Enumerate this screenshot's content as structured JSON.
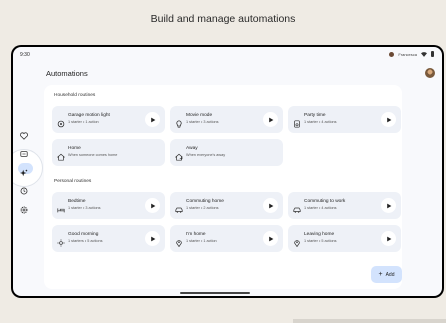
{
  "headline": "Build and manage automations",
  "status": {
    "time": "9:30",
    "user": "Francesca"
  },
  "page_title": "Automations",
  "sections": [
    {
      "title": "Household routines",
      "cards": [
        {
          "title": "Garage motion light",
          "subtitle": "1 starter • 1 action",
          "icon": "motion-sensor-icon",
          "has_play": true
        },
        {
          "title": "Movie mode",
          "subtitle": "1 starter • 3 actions",
          "icon": "lightbulb-icon",
          "has_play": true
        },
        {
          "title": "Party time",
          "subtitle": "1 starter • 4 actions",
          "icon": "speaker-icon",
          "has_play": true
        },
        {
          "title": "Home",
          "subtitle": "When someone comes home",
          "icon": "home-icon",
          "has_play": false
        },
        {
          "title": "Away",
          "subtitle": "When everyone's away",
          "icon": "away-icon",
          "has_play": false
        }
      ]
    },
    {
      "title": "Personal routines",
      "cards": [
        {
          "title": "Bedtime",
          "subtitle": "1 starter • 3 actions",
          "icon": "bed-icon",
          "has_play": true
        },
        {
          "title": "Commuting home",
          "subtitle": "1 starter • 2 actions",
          "icon": "car-icon",
          "has_play": true
        },
        {
          "title": "Commuting to work",
          "subtitle": "1 starter • 4 actions",
          "icon": "car-icon",
          "has_play": true
        },
        {
          "title": "Good morning",
          "subtitle": "1 starters • 5 actions",
          "icon": "sun-icon",
          "has_play": true
        },
        {
          "title": "I'm home",
          "subtitle": "1 starter • 1 action",
          "icon": "location-icon",
          "has_play": true
        },
        {
          "title": "Leaving home",
          "subtitle": "1 starter • 5 actions",
          "icon": "location-icon",
          "has_play": true
        }
      ]
    }
  ],
  "add_label": "Add",
  "colors": {
    "accent": "#d3e3fd",
    "card_bg": "#eef1f7",
    "page_bg": "#efebe4"
  }
}
